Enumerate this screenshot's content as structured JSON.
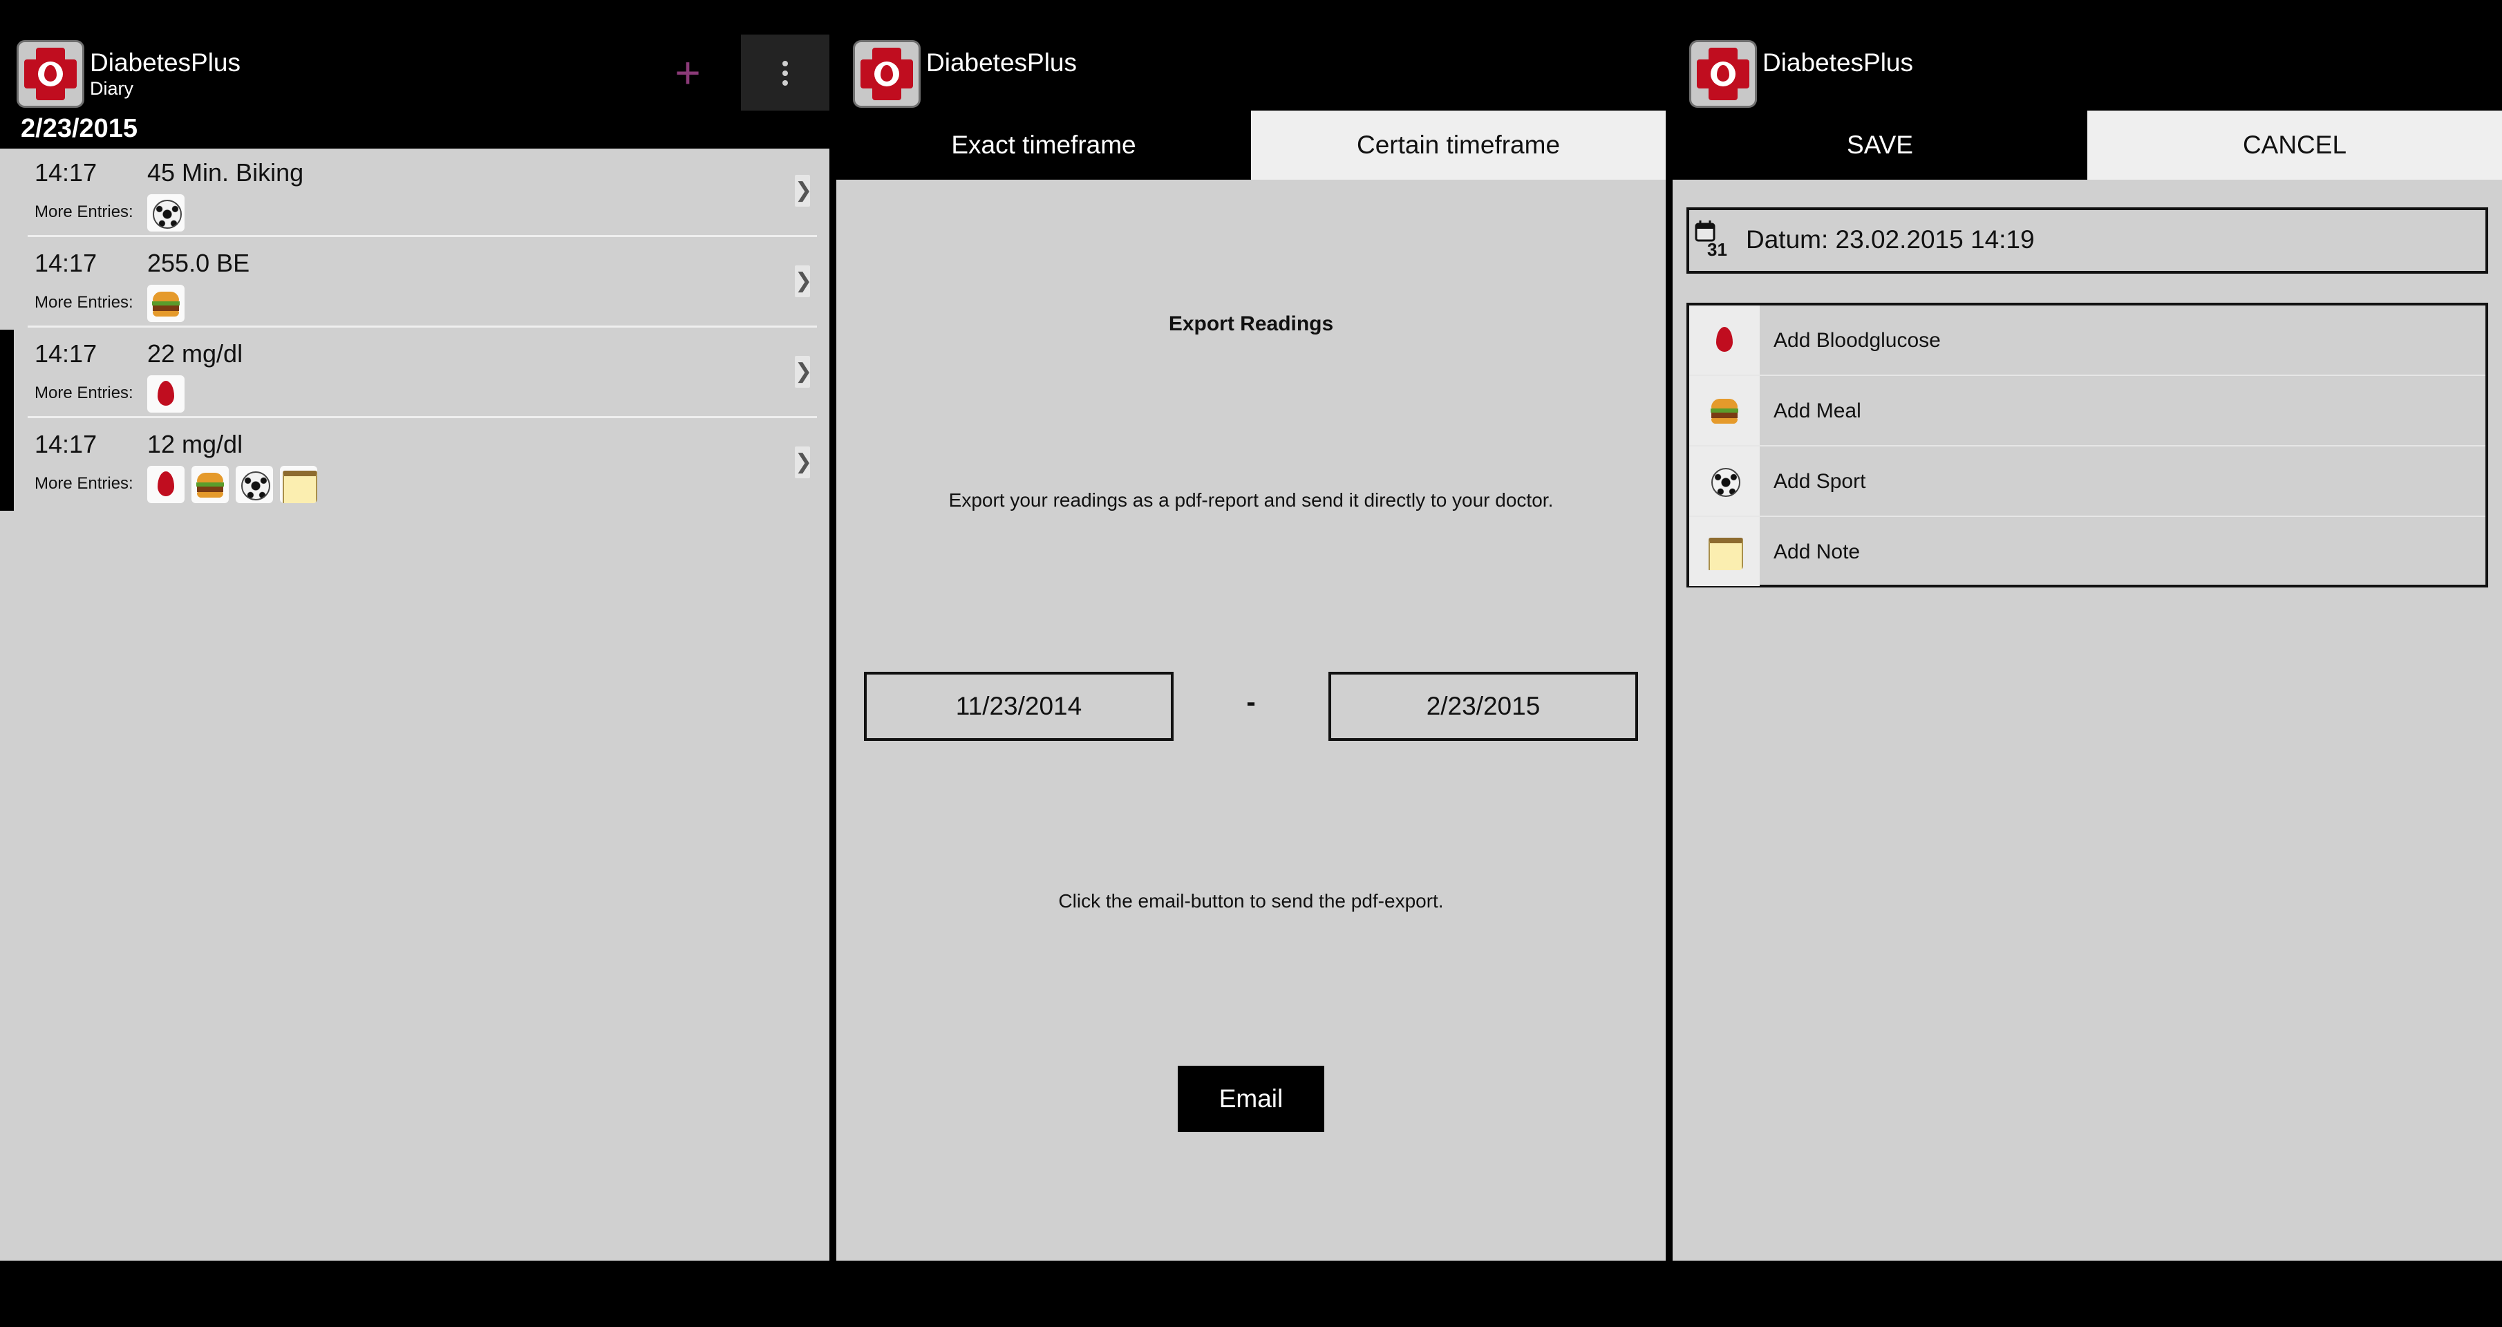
{
  "app": {
    "title": "DiabetesPlus"
  },
  "diary": {
    "subtitle": "Diary",
    "add_label": "+",
    "date": "2/23/2015",
    "more_label": "More Entries:",
    "entries": [
      {
        "time": "14:17",
        "value": "45 Min. Biking",
        "icons": [
          "sport"
        ]
      },
      {
        "time": "14:17",
        "value": "255.0 BE",
        "icons": [
          "meal"
        ]
      },
      {
        "time": "14:17",
        "value": "22 mg/dl",
        "icons": [
          "bloodglucose"
        ]
      },
      {
        "time": "14:17",
        "value": "12 mg/dl",
        "icons": [
          "bloodglucose",
          "meal",
          "sport",
          "note"
        ]
      }
    ],
    "chevron": "❯"
  },
  "export": {
    "tabs": [
      "Exact timeframe",
      "Certain timeframe"
    ],
    "heading": "Export Readings",
    "description": "Export your readings as a pdf-report and send it directly to your doctor.",
    "date_from": "11/23/2014",
    "separator": "-",
    "date_to": "2/23/2015",
    "hint": "Click the email-button to send the pdf-export.",
    "email_label": "Email"
  },
  "entry": {
    "save_label": "SAVE",
    "cancel_label": "CANCEL",
    "datum": "Datum: 23.02.2015 14:19",
    "calendar_day": "31",
    "items": [
      {
        "label": "Add Bloodglucose",
        "icon": "bloodglucose"
      },
      {
        "label": "Add Meal",
        "icon": "meal"
      },
      {
        "label": "Add Sport",
        "icon": "sport"
      },
      {
        "label": "Add Note",
        "icon": "note"
      }
    ]
  },
  "colors": {
    "accent_red": "#c00d1f",
    "plus_purple": "#8b3a78",
    "panel_gray": "#d0d0d0",
    "tab_light": "#efefef"
  }
}
